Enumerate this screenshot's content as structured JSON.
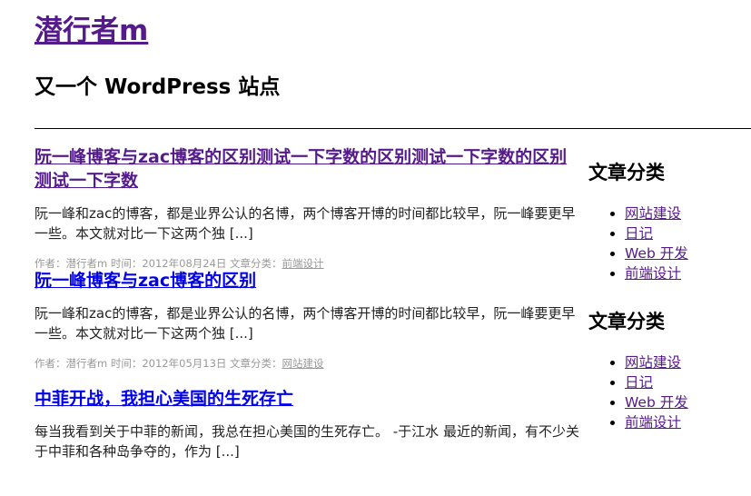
{
  "header": {
    "site_title": "潜行者m",
    "site_description": "又一个 WordPress 站点"
  },
  "posts": [
    {
      "title": "阮一峰博客与zac博客的区别测试一下字数的区别测试一下字数的区别测试一下字数",
      "excerpt": "阮一峰和zac的博客，都是业界公认的名博，两个博客开博的时间都比较早，阮一峰要更早一些。本文就对比一下这两个独 [...]",
      "meta_prefix": "作者：潜行者m 时间：2012年08月24日 文章分类：",
      "category": "前端设计"
    },
    {
      "title": "阮一峰博客与zac博客的区别",
      "excerpt": "阮一峰和zac的博客，都是业界公认的名博，两个博客开博的时间都比较早，阮一峰要更早一些。本文就对比一下这两个独 [...]",
      "meta_prefix": "作者：潜行者m 时间：2012年05月13日 文章分类：",
      "category": "网站建设"
    },
    {
      "title": "中菲开战，我担心美国的生死存亡",
      "excerpt": "每当我看到关于中菲的新闻，我总在担心美国的生死存亡。 -于江水 最近的新闻，有不少关于中菲和各种岛争夺的，作为 [...]"
    }
  ],
  "sidebar": {
    "widgets": [
      {
        "title": "文章分类",
        "items": [
          "网站建设",
          "日记",
          "Web 开发",
          "前端设计"
        ]
      },
      {
        "title": "文章分类",
        "items": [
          "网站建设",
          "日记",
          "Web 开发",
          "前端设计"
        ]
      }
    ]
  }
}
